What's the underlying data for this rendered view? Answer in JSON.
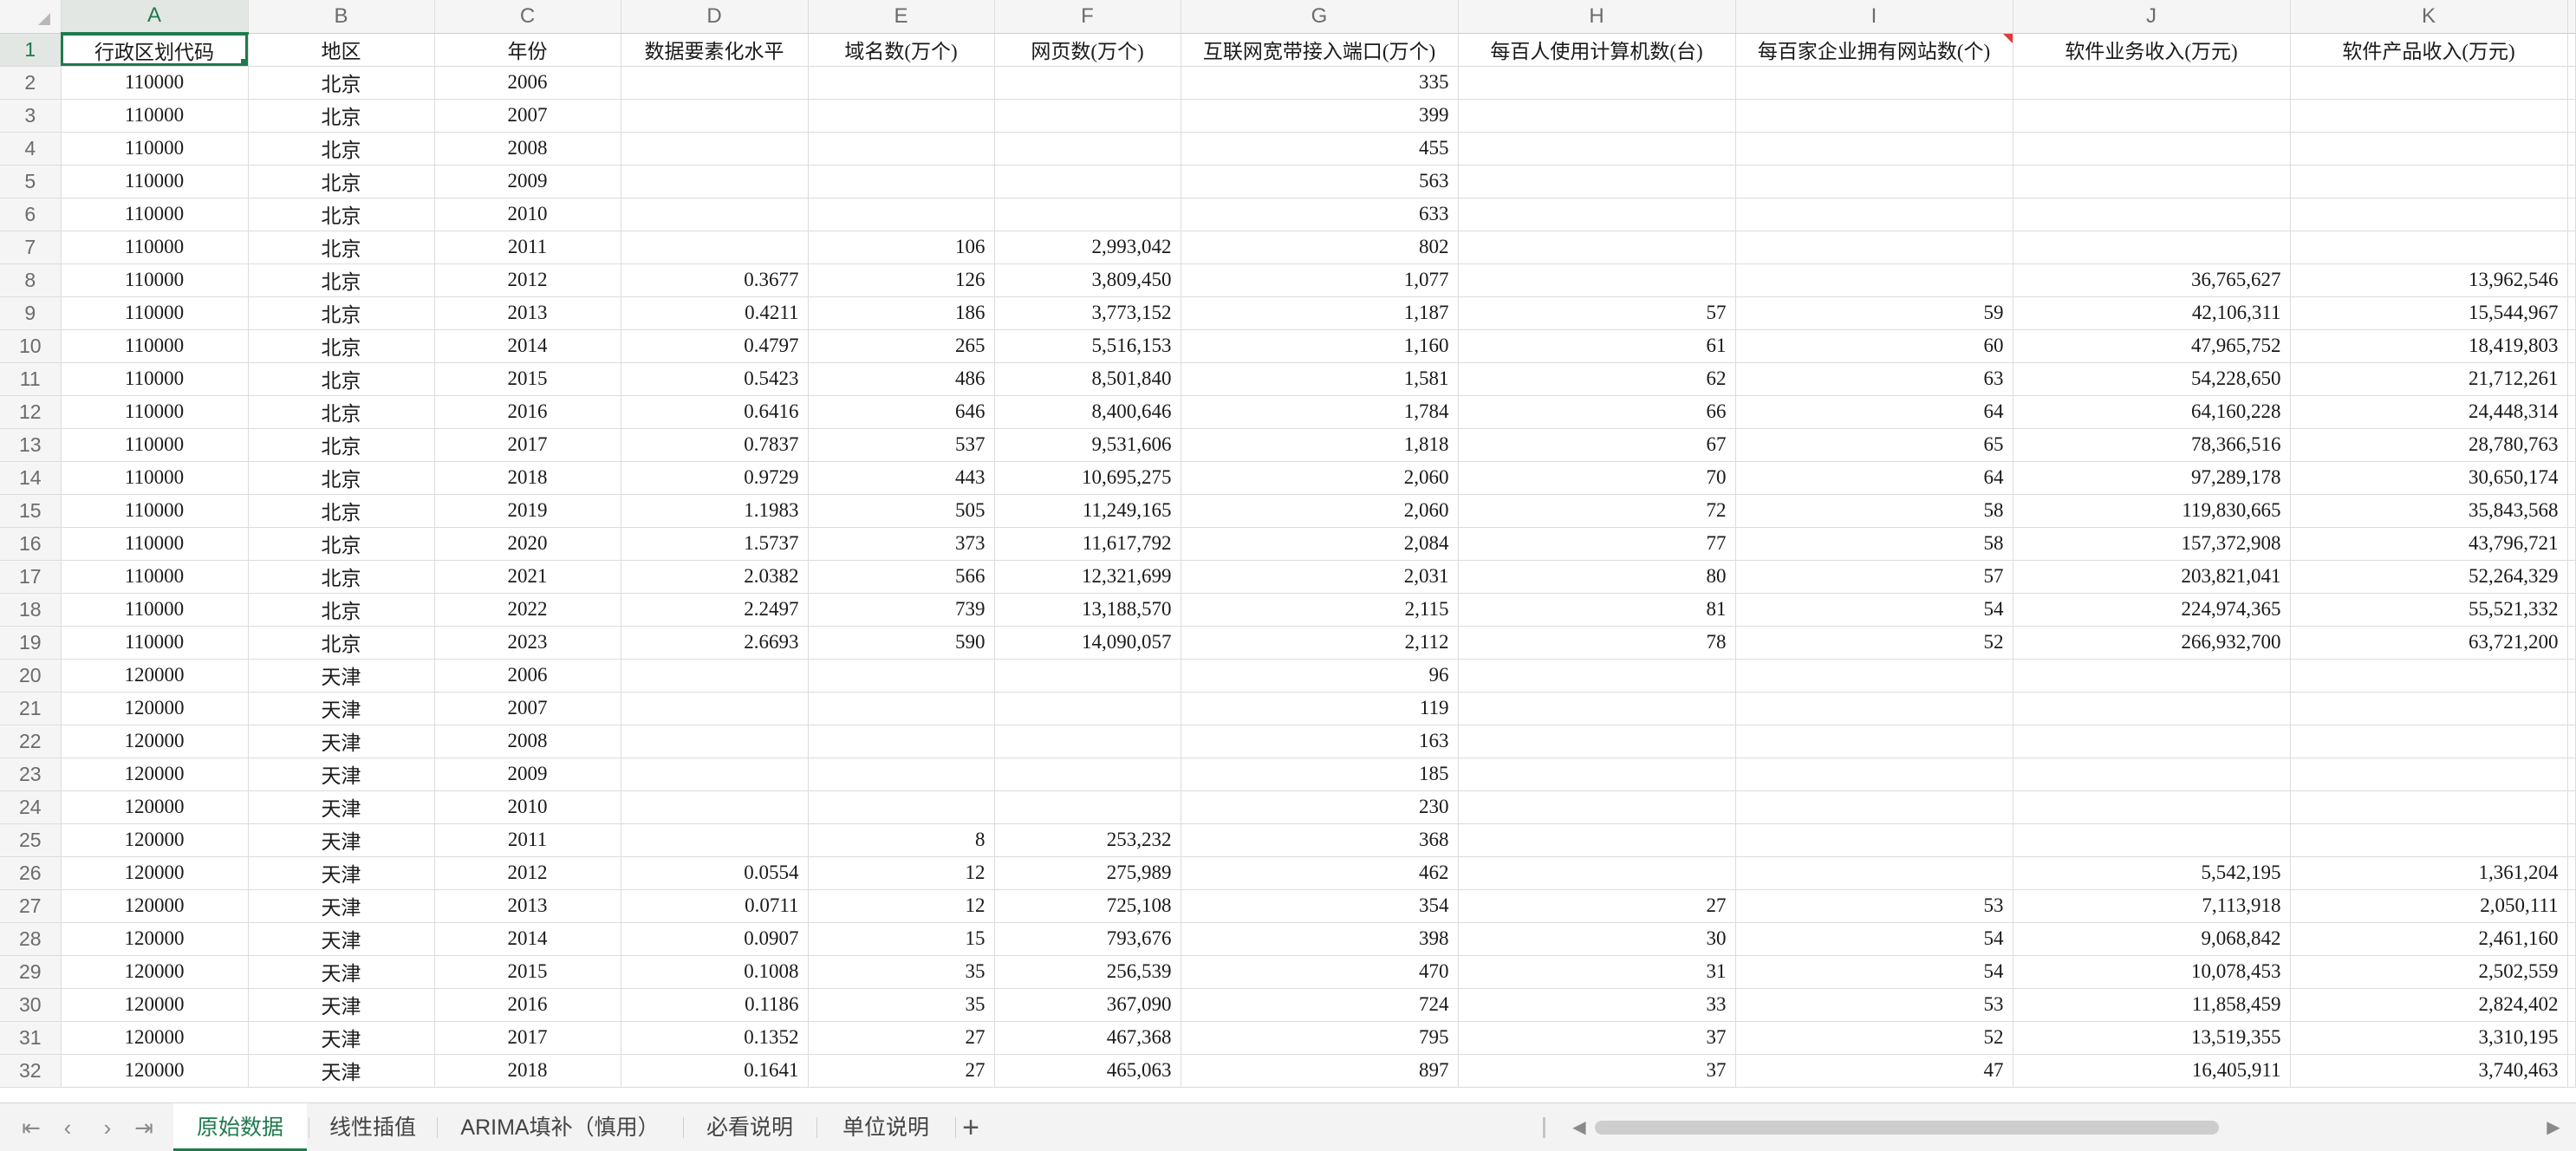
{
  "sheet": {
    "columns": [
      "A",
      "B",
      "C",
      "D",
      "E",
      "F",
      "G",
      "H",
      "I",
      "J",
      "K"
    ],
    "header": [
      "行政区划代码",
      "地区",
      "年份",
      "数据要素化水平",
      "域名数(万个)",
      "网页数(万个)",
      "互联网宽带接入端口(万个)",
      "每百人使用计算机数(台)",
      "每百家企业拥有网站数(个)",
      "软件业务收入(万元)",
      "软件产品收入(万元)"
    ],
    "rows": [
      {
        "num": "2",
        "cells": [
          "110000",
          "北京",
          "2006",
          "",
          "",
          "",
          "335",
          "",
          "",
          "",
          ""
        ]
      },
      {
        "num": "3",
        "cells": [
          "110000",
          "北京",
          "2007",
          "",
          "",
          "",
          "399",
          "",
          "",
          "",
          ""
        ]
      },
      {
        "num": "4",
        "cells": [
          "110000",
          "北京",
          "2008",
          "",
          "",
          "",
          "455",
          "",
          "",
          "",
          ""
        ]
      },
      {
        "num": "5",
        "cells": [
          "110000",
          "北京",
          "2009",
          "",
          "",
          "",
          "563",
          "",
          "",
          "",
          ""
        ]
      },
      {
        "num": "6",
        "cells": [
          "110000",
          "北京",
          "2010",
          "",
          "",
          "",
          "633",
          "",
          "",
          "",
          ""
        ]
      },
      {
        "num": "7",
        "cells": [
          "110000",
          "北京",
          "2011",
          "",
          "106",
          "2,993,042",
          "802",
          "",
          "",
          "",
          ""
        ]
      },
      {
        "num": "8",
        "cells": [
          "110000",
          "北京",
          "2012",
          "0.3677",
          "126",
          "3,809,450",
          "1,077",
          "",
          "",
          "36,765,627",
          "13,962,546"
        ]
      },
      {
        "num": "9",
        "cells": [
          "110000",
          "北京",
          "2013",
          "0.4211",
          "186",
          "3,773,152",
          "1,187",
          "57",
          "59",
          "42,106,311",
          "15,544,967"
        ]
      },
      {
        "num": "10",
        "cells": [
          "110000",
          "北京",
          "2014",
          "0.4797",
          "265",
          "5,516,153",
          "1,160",
          "61",
          "60",
          "47,965,752",
          "18,419,803"
        ]
      },
      {
        "num": "11",
        "cells": [
          "110000",
          "北京",
          "2015",
          "0.5423",
          "486",
          "8,501,840",
          "1,581",
          "62",
          "63",
          "54,228,650",
          "21,712,261"
        ]
      },
      {
        "num": "12",
        "cells": [
          "110000",
          "北京",
          "2016",
          "0.6416",
          "646",
          "8,400,646",
          "1,784",
          "66",
          "64",
          "64,160,228",
          "24,448,314"
        ]
      },
      {
        "num": "13",
        "cells": [
          "110000",
          "北京",
          "2017",
          "0.7837",
          "537",
          "9,531,606",
          "1,818",
          "67",
          "65",
          "78,366,516",
          "28,780,763"
        ]
      },
      {
        "num": "14",
        "cells": [
          "110000",
          "北京",
          "2018",
          "0.9729",
          "443",
          "10,695,275",
          "2,060",
          "70",
          "64",
          "97,289,178",
          "30,650,174"
        ]
      },
      {
        "num": "15",
        "cells": [
          "110000",
          "北京",
          "2019",
          "1.1983",
          "505",
          "11,249,165",
          "2,060",
          "72",
          "58",
          "119,830,665",
          "35,843,568"
        ]
      },
      {
        "num": "16",
        "cells": [
          "110000",
          "北京",
          "2020",
          "1.5737",
          "373",
          "11,617,792",
          "2,084",
          "77",
          "58",
          "157,372,908",
          "43,796,721"
        ]
      },
      {
        "num": "17",
        "cells": [
          "110000",
          "北京",
          "2021",
          "2.0382",
          "566",
          "12,321,699",
          "2,031",
          "80",
          "57",
          "203,821,041",
          "52,264,329"
        ]
      },
      {
        "num": "18",
        "cells": [
          "110000",
          "北京",
          "2022",
          "2.2497",
          "739",
          "13,188,570",
          "2,115",
          "81",
          "54",
          "224,974,365",
          "55,521,332"
        ]
      },
      {
        "num": "19",
        "cells": [
          "110000",
          "北京",
          "2023",
          "2.6693",
          "590",
          "14,090,057",
          "2,112",
          "78",
          "52",
          "266,932,700",
          "63,721,200"
        ]
      },
      {
        "num": "20",
        "cells": [
          "120000",
          "天津",
          "2006",
          "",
          "",
          "",
          "96",
          "",
          "",
          "",
          ""
        ]
      },
      {
        "num": "21",
        "cells": [
          "120000",
          "天津",
          "2007",
          "",
          "",
          "",
          "119",
          "",
          "",
          "",
          ""
        ]
      },
      {
        "num": "22",
        "cells": [
          "120000",
          "天津",
          "2008",
          "",
          "",
          "",
          "163",
          "",
          "",
          "",
          ""
        ]
      },
      {
        "num": "23",
        "cells": [
          "120000",
          "天津",
          "2009",
          "",
          "",
          "",
          "185",
          "",
          "",
          "",
          ""
        ]
      },
      {
        "num": "24",
        "cells": [
          "120000",
          "天津",
          "2010",
          "",
          "",
          "",
          "230",
          "",
          "",
          "",
          ""
        ]
      },
      {
        "num": "25",
        "cells": [
          "120000",
          "天津",
          "2011",
          "",
          "8",
          "253,232",
          "368",
          "",
          "",
          "",
          ""
        ]
      },
      {
        "num": "26",
        "cells": [
          "120000",
          "天津",
          "2012",
          "0.0554",
          "12",
          "275,989",
          "462",
          "",
          "",
          "5,542,195",
          "1,361,204"
        ]
      },
      {
        "num": "27",
        "cells": [
          "120000",
          "天津",
          "2013",
          "0.0711",
          "12",
          "725,108",
          "354",
          "27",
          "53",
          "7,113,918",
          "2,050,111"
        ]
      },
      {
        "num": "28",
        "cells": [
          "120000",
          "天津",
          "2014",
          "0.0907",
          "15",
          "793,676",
          "398",
          "30",
          "54",
          "9,068,842",
          "2,461,160"
        ]
      },
      {
        "num": "29",
        "cells": [
          "120000",
          "天津",
          "2015",
          "0.1008",
          "35",
          "256,539",
          "470",
          "31",
          "54",
          "10,078,453",
          "2,502,559"
        ]
      },
      {
        "num": "30",
        "cells": [
          "120000",
          "天津",
          "2016",
          "0.1186",
          "35",
          "367,090",
          "724",
          "33",
          "53",
          "11,858,459",
          "2,824,402"
        ]
      },
      {
        "num": "31",
        "cells": [
          "120000",
          "天津",
          "2017",
          "0.1352",
          "27",
          "467,368",
          "795",
          "37",
          "52",
          "13,519,355",
          "3,310,195"
        ]
      },
      {
        "num": "32",
        "cells": [
          "120000",
          "天津",
          "2018",
          "0.1641",
          "27",
          "465,063",
          "897",
          "37",
          "47",
          "16,405,911",
          "3,740,463"
        ]
      }
    ]
  },
  "tabs": [
    "原始数据",
    "线性插值",
    "ARIMA填补（慎用）",
    "必看说明",
    "单位说明"
  ],
  "active_tab": 0,
  "controls": {
    "first_sheet_icon": "first-sheet-icon",
    "prev_sheet_icon": "prev-sheet-icon",
    "next_sheet_icon": "next-sheet-icon",
    "last_sheet_icon": "last-sheet-icon",
    "add_sheet_icon": "add-sheet-icon"
  },
  "colors": {
    "accent": "#1f7a4d",
    "comment_marker": "#e23b3b"
  }
}
